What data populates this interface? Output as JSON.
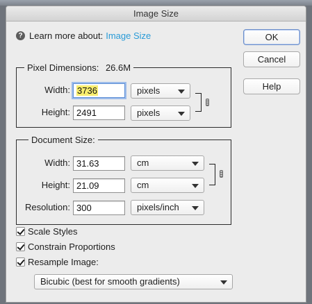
{
  "window": {
    "title": "Image Size"
  },
  "help": {
    "prefix": "Learn more about:",
    "link": "Image Size"
  },
  "buttons": {
    "ok": "OK",
    "cancel": "Cancel",
    "help": "Help"
  },
  "pixel_dimensions": {
    "legend": "Pixel Dimensions:",
    "size": "26.6M",
    "width_label": "Width:",
    "width_value": "3736",
    "width_unit": "pixels",
    "height_label": "Height:",
    "height_value": "2491",
    "height_unit": "pixels"
  },
  "document_size": {
    "legend": "Document Size:",
    "width_label": "Width:",
    "width_value": "31.63",
    "width_unit": "cm",
    "height_label": "Height:",
    "height_value": "21.09",
    "height_unit": "cm",
    "resolution_label": "Resolution:",
    "resolution_value": "300",
    "resolution_unit": "pixels/inch"
  },
  "options": {
    "scale_styles": {
      "label": "Scale Styles",
      "checked": true
    },
    "constrain_proportions": {
      "label": "Constrain Proportions",
      "checked": true
    },
    "resample_image": {
      "label": "Resample Image:",
      "checked": true
    },
    "resample_method": "Bicubic (best for smooth gradients)"
  },
  "colors": {
    "link": "#2a9bd7",
    "selection_highlight": "#f8ee6f",
    "focus_ring": "#9dbcea"
  },
  "icons": [
    "help-icon",
    "chain-link-icon",
    "dropdown-arrow-icon",
    "checkmark-icon"
  ]
}
